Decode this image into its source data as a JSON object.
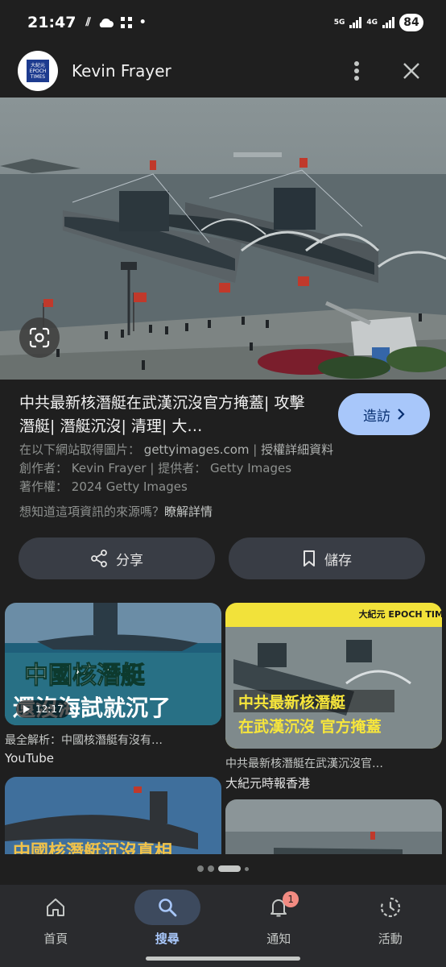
{
  "status_bar": {
    "time": "21:47",
    "net1": "5G",
    "net2": "4G",
    "battery": "84"
  },
  "header": {
    "site_name": "Kevin Frayer",
    "logo_text": "大紀元 EPOCH TIMES"
  },
  "result": {
    "title": "中共最新核潛艇在武漢沉沒官方掩蓋| 攻擊潛艇| 潛艇沉沒| 清理| 大…",
    "visit_label": "造訪",
    "source_prefix": "在以下網站取得圖片：",
    "source_site": "gettyimages.com",
    "license_sep": " | ",
    "license_link": "授權詳細資料",
    "creator_prefix": "創作者：",
    "creator": "Kevin Frayer",
    "provider_prefix": " | 提供者：",
    "provider": "Getty Images",
    "copyright_prefix": "著作權：",
    "copyright": "2024 Getty Images",
    "question": "想知道這項資訊的來源嗎？",
    "learn_more": "瞭解詳情"
  },
  "actions": {
    "share_label": "分享",
    "save_label": "儲存"
  },
  "related": [
    {
      "caption": "最全解析：中國核潛艇有沒有…",
      "source": "YouTube",
      "overlay_line1": "中國核潛艇",
      "overlay_line2": "還沒海試就沉了",
      "duration": "12:17"
    },
    {
      "caption": "中共最新核潛艇在武漢沉沒官…",
      "source": "大紀元時報香港",
      "overlay_line1": "中共最新核潛艇",
      "overlay_line2": "在武漢沉沒 官方掩蓋",
      "brand": "大紀元 EPOCH TIMES"
    },
    {
      "overlay_line1": "中國核潛艇沉沒真相"
    },
    {}
  ],
  "bottom_nav": [
    {
      "label": "首頁",
      "icon": "home-icon"
    },
    {
      "label": "搜尋",
      "icon": "search-icon"
    },
    {
      "label": "通知",
      "icon": "bell-icon",
      "badge": "1"
    },
    {
      "label": "活動",
      "icon": "activity-icon"
    }
  ],
  "colors": {
    "background": "#1f1f1f",
    "accent": "#a8c7fa",
    "pill": "#393d45",
    "nav_active": "#3d4a5e",
    "badge": "#f28b82"
  }
}
